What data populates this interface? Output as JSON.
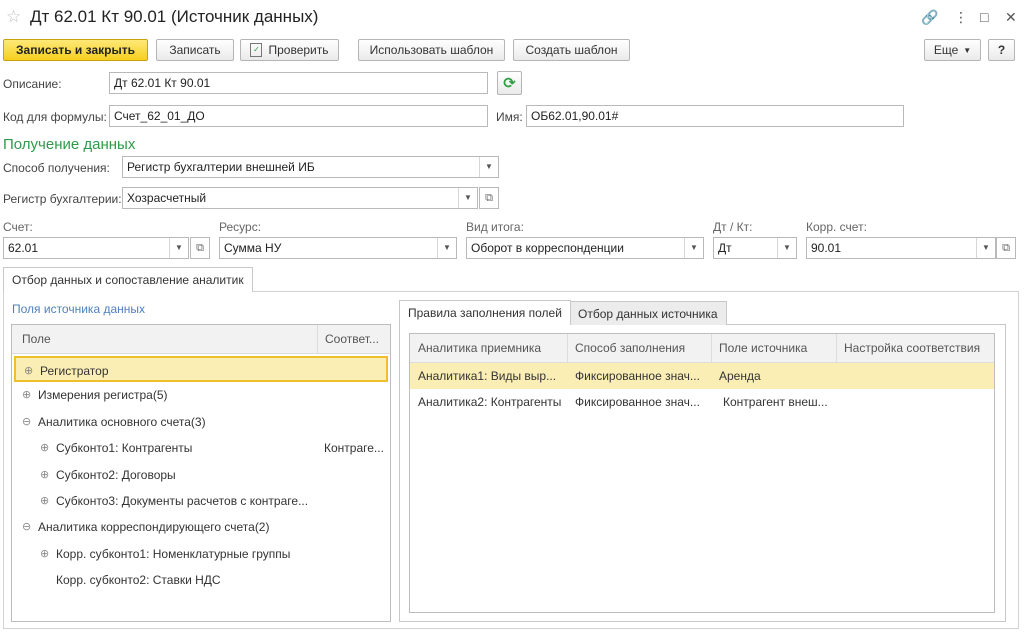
{
  "window": {
    "title": "Дт 62.01 Кт 90.01 (Источник данных)",
    "star_glyph": "☆",
    "controls": {
      "link": "🔗",
      "more": "⋮",
      "max": "□",
      "close": "✕"
    }
  },
  "toolbar": {
    "save_close": "Записать и закрыть",
    "save": "Записать",
    "check": "Проверить",
    "use_template": "Использовать шаблон",
    "create_template": "Создать шаблон",
    "more": "Еще",
    "help": "?"
  },
  "form": {
    "description_label": "Описание:",
    "description_value": "Дт 62.01 Кт 90.01",
    "formula_code_label": "Код для формулы:",
    "formula_code_value": "Счет_62_01_ДО",
    "name_label": "Имя:",
    "name_value": "ОБ62.01,90.01#"
  },
  "data_section": {
    "title": "Получение данных",
    "method_label": "Способ получения:",
    "method_value": "Регистр бухгалтерии внешней ИБ",
    "register_label": "Регистр бухгалтерии:",
    "register_value": "Хозрасчетный",
    "account_label": "Счет:",
    "account_value": "62.01",
    "resource_label": "Ресурс:",
    "resource_value": "Сумма НУ",
    "total_type_label": "Вид итога:",
    "total_type_value": "Оборот в корреспонденции",
    "dt_kt_label": "Дт / Кт:",
    "dt_kt_value": "Дт",
    "corr_account_label": "Корр. счет:",
    "corr_account_value": "90.01"
  },
  "main_tab": {
    "label": "Отбор данных и сопоставление аналитик"
  },
  "source_fields": {
    "title": "Поля источника данных",
    "col_field": "Поле",
    "col_match": "Соответ...",
    "rows": [
      {
        "label": "Регистратор",
        "match": "",
        "indent": 0,
        "expander": "⊕"
      },
      {
        "label": "Измерения регистра(5)",
        "match": "",
        "indent": 0,
        "expander": "⊕"
      },
      {
        "label": "Аналитика основного счета(3)",
        "match": "",
        "indent": 0,
        "expander": "⊖"
      },
      {
        "label": "Субконто1: Контрагенты",
        "match": "Контраге...",
        "indent": 1,
        "expander": "⊕"
      },
      {
        "label": "Субконто2: Договоры",
        "match": "",
        "indent": 1,
        "expander": "⊕"
      },
      {
        "label": "Субконто3: Документы расчетов с контраге...",
        "match": "",
        "indent": 1,
        "expander": "⊕"
      },
      {
        "label": "Аналитика корреспондирующего счета(2)",
        "match": "",
        "indent": 0,
        "expander": "⊖"
      },
      {
        "label": "Корр. субконто1: Номенклатурные группы",
        "match": "",
        "indent": 1,
        "expander": "⊕"
      },
      {
        "label": "Корр. субконто2: Ставки НДС",
        "match": "",
        "indent": 1,
        "expander": ""
      }
    ]
  },
  "right_tabs": {
    "fill_rules": "Правила заполнения полей",
    "source_filter": "Отбор данных источника"
  },
  "rules_table": {
    "headers": [
      "Аналитика приемника",
      "Способ заполнения",
      "Поле источника",
      "Настройка соответствия"
    ],
    "rows": [
      [
        "Аналитика1: Виды выр...",
        "Фиксированное знач...",
        "Аренда",
        ""
      ],
      [
        "Аналитика2: Контрагенты",
        "Фиксированное знач...",
        "Контрагент внеш...",
        ""
      ]
    ]
  },
  "colors": {
    "primary_button": "#f5cf1f",
    "section_title": "#2e9a4a",
    "link": "#4f7fc0",
    "selection": "#fbeeb5",
    "refresh_icon": "#2ea043"
  }
}
